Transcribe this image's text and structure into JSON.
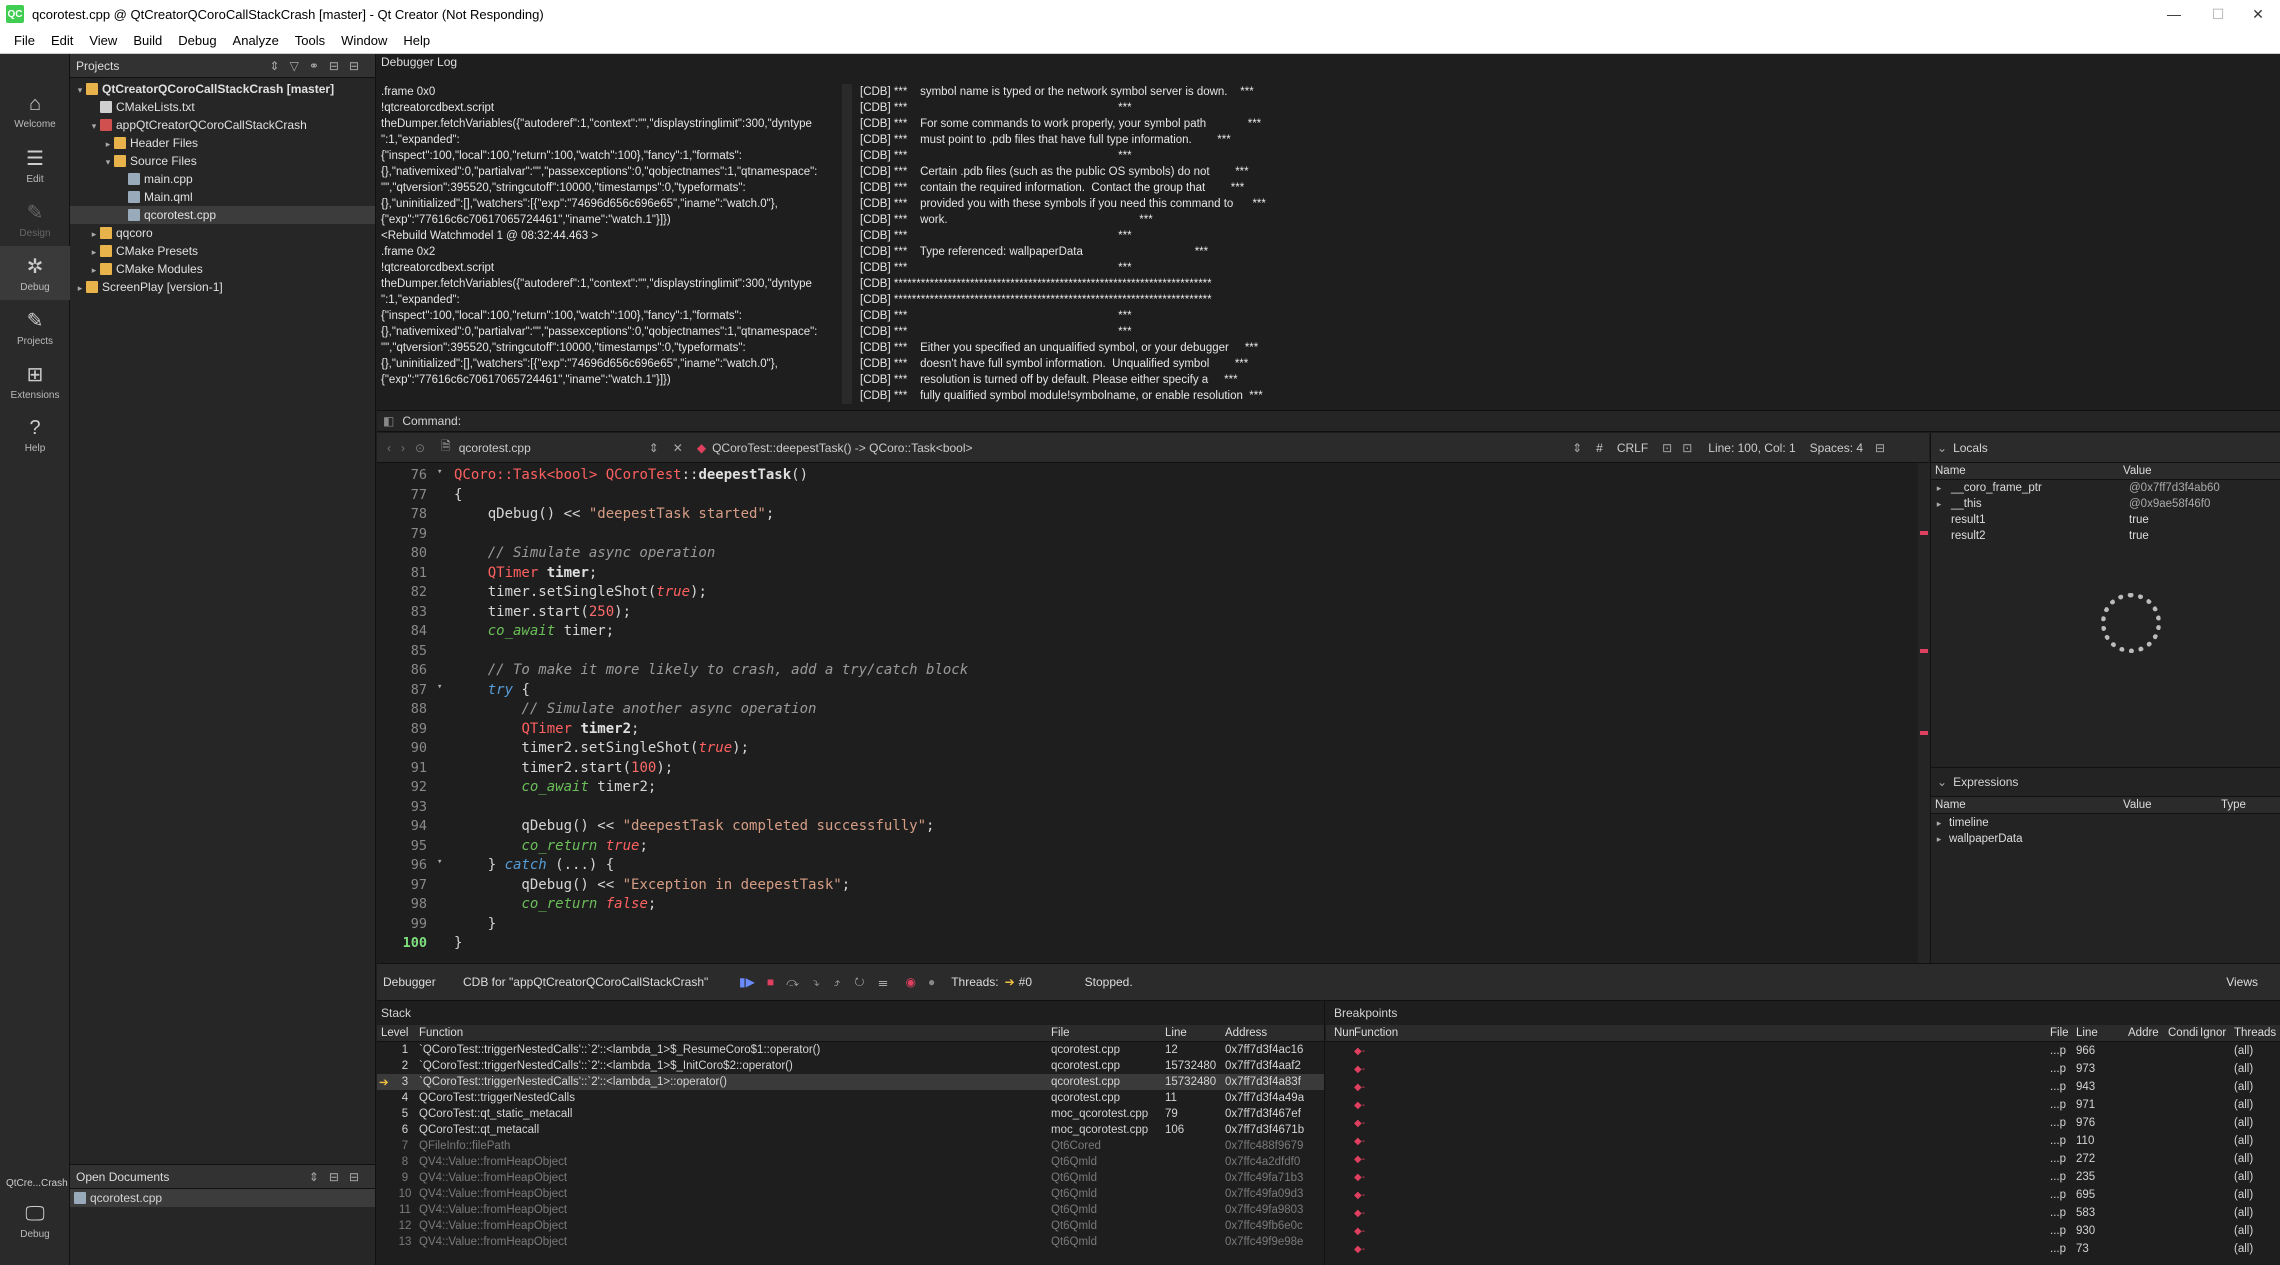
{
  "window": {
    "title": "qcorotest.cpp @ QtCreatorQCoroCallStackCrash [master] - Qt Creator (Not Responding)",
    "logo": "QC"
  },
  "menu": [
    "File",
    "Edit",
    "View",
    "Build",
    "Debug",
    "Analyze",
    "Tools",
    "Window",
    "Help"
  ],
  "modes": [
    {
      "label": "Welcome",
      "icon": "⌂"
    },
    {
      "label": "Edit",
      "icon": "☰"
    },
    {
      "label": "Design",
      "icon": "✎"
    },
    {
      "label": "Debug",
      "icon": "✲"
    },
    {
      "label": "Projects",
      "icon": "✎"
    },
    {
      "label": "Extensions",
      "icon": "⊞"
    },
    {
      "label": "Help",
      "icon": "?"
    }
  ],
  "kit": {
    "name": "QtCre...Crash",
    "mode": "Debug"
  },
  "projects": {
    "title": "Projects",
    "tree": [
      {
        "label": "QtCreatorQCoroCallStackCrash [master]",
        "indent": 0,
        "arrow": "▾",
        "color": "#e8b34a",
        "bold": true
      },
      {
        "label": "CMakeLists.txt",
        "indent": 1,
        "arrow": "",
        "color": "#cfcfcf"
      },
      {
        "label": "appQtCreatorQCoroCallStackCrash",
        "indent": 1,
        "arrow": "▾",
        "color": "#d05050"
      },
      {
        "label": "Header Files",
        "indent": 2,
        "arrow": "▸",
        "color": "#e8b34a"
      },
      {
        "label": "Source Files",
        "indent": 2,
        "arrow": "▾",
        "color": "#e8b34a"
      },
      {
        "label": "main.cpp",
        "indent": 3,
        "arrow": "",
        "color": "#9ab"
      },
      {
        "label": "Main.qml",
        "indent": 3,
        "arrow": "",
        "color": "#9ab"
      },
      {
        "label": "qcorotest.cpp",
        "indent": 3,
        "arrow": "",
        "color": "#9ab",
        "selected": true
      },
      {
        "label": "qqcoro",
        "indent": 1,
        "arrow": "▸",
        "color": "#e8b34a"
      },
      {
        "label": "CMake Presets",
        "indent": 1,
        "arrow": "▸",
        "color": "#e8b34a"
      },
      {
        "label": "CMake Modules",
        "indent": 1,
        "arrow": "▸",
        "color": "#e8b34a"
      },
      {
        "label": "ScreenPlay [version-1]",
        "indent": 0,
        "arrow": "▸",
        "color": "#e8b34a"
      }
    ]
  },
  "open_documents": {
    "title": "Open Documents",
    "items": [
      "qcorotest.cpp"
    ]
  },
  "debugger_log": {
    "title": "Debugger Log",
    "left": [
      ".frame 0x0",
      "!qtcreatorcdbext.script",
      "theDumper.fetchVariables({\"autoderef\":1,\"context\":\"\",\"displaystringlimit\":300,\"dyntype",
      "\":1,\"expanded\":",
      "{\"inspect\":100,\"local\":100,\"return\":100,\"watch\":100},\"fancy\":1,\"formats\":",
      "{},\"nativemixed\":0,\"partialvar\":\"\",\"passexceptions\":0,\"qobjectnames\":1,\"qtnamespace\":",
      "\"\",\"qtversion\":395520,\"stringcutoff\":10000,\"timestamps\":0,\"typeformats\":",
      "{},\"uninitialized\":[],\"watchers\":[{\"exp\":\"74696d656c696e65\",\"iname\":\"watch.0\"},",
      "{\"exp\":\"77616c6c70617065724461\",\"iname\":\"watch.1\"}]})",
      "<Rebuild Watchmodel 1 @ 08:32:44.463 >",
      ".frame 0x2",
      "!qtcreatorcdbext.script",
      "theDumper.fetchVariables({\"autoderef\":1,\"context\":\"\",\"displaystringlimit\":300,\"dyntype",
      "\":1,\"expanded\":",
      "{\"inspect\":100,\"local\":100,\"return\":100,\"watch\":100},\"fancy\":1,\"formats\":",
      "{},\"nativemixed\":0,\"partialvar\":\"\",\"passexceptions\":0,\"qobjectnames\":1,\"qtnamespace\":",
      "\"\",\"qtversion\":395520,\"stringcutoff\":10000,\"timestamps\":0,\"typeformats\":",
      "{},\"uninitialized\":[],\"watchers\":[{\"exp\":\"74696d656c696e65\",\"iname\":\"watch.0\"},",
      "{\"exp\":\"77616c6c70617065724461\",\"iname\":\"watch.1\"}]})"
    ],
    "right": [
      "[CDB] ***    symbol name is typed or the network symbol server is down.    ***",
      "[CDB] ***                                                                  ***",
      "[CDB] ***    For some commands to work properly, your symbol path             ***",
      "[CDB] ***    must point to .pdb files that have full type information.        ***",
      "[CDB] ***                                                                  ***",
      "[CDB] ***    Certain .pdb files (such as the public OS symbols) do not        ***",
      "[CDB] ***    contain the required information.  Contact the group that        ***",
      "[CDB] ***    provided you with these symbols if you need this command to      ***",
      "[CDB] ***    work.                                                            ***",
      "[CDB] ***                                                                  ***",
      "[CDB] ***    Type referenced: wallpaperData                                   ***",
      "[CDB] ***                                                                  ***",
      "[CDB] ***********************************************************************",
      "[CDB] ***********************************************************************",
      "[CDB] ***                                                                  ***",
      "[CDB] ***                                                                  ***",
      "[CDB] ***    Either you specified an unqualified symbol, or your debugger     ***",
      "[CDB] ***    doesn't have full symbol information.  Unqualified symbol        ***",
      "[CDB] ***    resolution is turned off by default. Please either specify a     ***",
      "[CDB] ***    fully qualified symbol module!symbolname, or enable resolution  ***"
    ]
  },
  "command": {
    "label": "Command:"
  },
  "editor_toolbar": {
    "file": "qcorotest.cpp",
    "function": "QCoroTest::deepestTask() -> QCoro::Task<bool>",
    "hash": "#",
    "eol": "CRLF",
    "position": "Line: 100, Col: 1",
    "spaces": "Spaces: 4"
  },
  "code": {
    "current_line": "100",
    "lines": [
      {
        "n": "76",
        "fold": "▾",
        "html": "<span class='ty'>QCoro::Task&lt;bool&gt;</span> <span class='ty'>QCoroTest</span>::<span class='fn'>deepestTask</span>()"
      },
      {
        "n": "77",
        "fold": "",
        "html": "{"
      },
      {
        "n": "78",
        "fold": "",
        "html": "    qDebug() &lt;&lt; <span class='st'>\"deepestTask started\"</span>;"
      },
      {
        "n": "79",
        "fold": "",
        "html": ""
      },
      {
        "n": "80",
        "fold": "",
        "html": "    <span class='cm'>// Simulate async operation</span>"
      },
      {
        "n": "81",
        "fold": "",
        "html": "    <span class='ty'>QTimer</span> <span class='fn'>timer</span>;"
      },
      {
        "n": "82",
        "fold": "",
        "html": "    timer.setSingleShot(<span class='bo'>true</span>);"
      },
      {
        "n": "83",
        "fold": "",
        "html": "    timer.start(<span class='nu'>250</span>);"
      },
      {
        "n": "84",
        "fold": "",
        "html": "    <span class='cr'>co_await</span> timer;"
      },
      {
        "n": "85",
        "fold": "",
        "html": ""
      },
      {
        "n": "86",
        "fold": "",
        "html": "    <span class='cm'>// To make it more likely to crash, add a try/catch block</span>"
      },
      {
        "n": "87",
        "fold": "▾",
        "html": "    <span class='kw'>try</span> {"
      },
      {
        "n": "88",
        "fold": "",
        "html": "        <span class='cm'>// Simulate another async operation</span>"
      },
      {
        "n": "89",
        "fold": "",
        "html": "        <span class='ty'>QTimer</span> <span class='fn'>timer2</span>;"
      },
      {
        "n": "90",
        "fold": "",
        "html": "        timer2.setSingleShot(<span class='bo'>true</span>);"
      },
      {
        "n": "91",
        "fold": "",
        "html": "        timer2.start(<span class='nu'>100</span>);"
      },
      {
        "n": "92",
        "fold": "",
        "html": "        <span class='cr'>co_await</span> timer2;"
      },
      {
        "n": "93",
        "fold": "",
        "html": ""
      },
      {
        "n": "94",
        "fold": "",
        "html": "        qDebug() &lt;&lt; <span class='st'>\"deepestTask completed successfully\"</span>;"
      },
      {
        "n": "95",
        "fold": "",
        "html": "        <span class='cr'>co_return</span> <span class='bo'>true</span>;"
      },
      {
        "n": "96",
        "fold": "▾",
        "html": "    } <span class='kw'>catch</span> (...) {"
      },
      {
        "n": "97",
        "fold": "",
        "html": "        qDebug() &lt;&lt; <span class='st'>\"Exception in deepestTask\"</span>;"
      },
      {
        "n": "98",
        "fold": "",
        "html": "        <span class='cr'>co_return</span> <span class='bo'>false</span>;"
      },
      {
        "n": "99",
        "fold": "",
        "html": "    }"
      },
      {
        "n": "100",
        "fold": "",
        "html": "}"
      }
    ]
  },
  "locals": {
    "title": "Locals",
    "cols": [
      "Name",
      "Value"
    ],
    "rows": [
      {
        "name": "__coro_frame_ptr",
        "value": "@0x7ff7d3f4ab60",
        "arrow": "▸",
        "gray": true
      },
      {
        "name": "__this",
        "value": "@0x9ae58f46f0",
        "arrow": "▸",
        "gray": true
      },
      {
        "name": "result1",
        "value": "true",
        "arrow": ""
      },
      {
        "name": "result2",
        "value": "true",
        "arrow": ""
      }
    ]
  },
  "expressions": {
    "title": "Expressions",
    "cols": [
      "Name",
      "Value",
      "Type"
    ],
    "rows": [
      "timeline",
      "wallpaperData"
    ]
  },
  "debugger_bar": {
    "label": "Debugger",
    "engine": "CDB for \"appQtCreatorQCoroCallStackCrash\"",
    "threads_label": "Threads:",
    "thread": "#0",
    "status": "Stopped.",
    "views": "Views"
  },
  "stack": {
    "title": "Stack",
    "cols": [
      "Level",
      "Function",
      "File",
      "Line",
      "Address"
    ],
    "rows": [
      {
        "level": "1",
        "fn": "`QCoroTest::triggerNestedCalls'::`2'::<lambda_1>$_ResumeCoro$1::operator()",
        "file": "qcorotest.cpp",
        "line": "12",
        "addr": "0x7ff7d3f4ac16"
      },
      {
        "level": "2",
        "fn": "`QCoroTest::triggerNestedCalls'::`2'::<lambda_1>$_InitCoro$2::operator()",
        "file": "qcorotest.cpp",
        "line": "15732480",
        "addr": "0x7ff7d3f4aaf2"
      },
      {
        "level": "3",
        "fn": "`QCoroTest::triggerNestedCalls'::`2'::<lambda_1>::operator()",
        "file": "qcorotest.cpp",
        "line": "15732480",
        "addr": "0x7ff7d3f4a83f",
        "current": true
      },
      {
        "level": "4",
        "fn": "QCoroTest::triggerNestedCalls",
        "file": "qcorotest.cpp",
        "line": "11",
        "addr": "0x7ff7d3f4a49a"
      },
      {
        "level": "5",
        "fn": "QCoroTest::qt_static_metacall",
        "file": "moc_qcorotest.cpp",
        "line": "79",
        "addr": "0x7ff7d3f467ef"
      },
      {
        "level": "6",
        "fn": "QCoroTest::qt_metacall",
        "file": "moc_qcorotest.cpp",
        "line": "106",
        "addr": "0x7ff7d3f4671b"
      },
      {
        "level": "7",
        "fn": "QFileInfo::filePath",
        "file": "Qt6Cored",
        "line": "",
        "addr": "0x7ffc488f9679",
        "gray": true
      },
      {
        "level": "8",
        "fn": "QV4::Value::fromHeapObject",
        "file": "Qt6Qmld",
        "line": "",
        "addr": "0x7ffc4a2dfdf0",
        "gray": true
      },
      {
        "level": "9",
        "fn": "QV4::Value::fromHeapObject",
        "file": "Qt6Qmld",
        "line": "",
        "addr": "0x7ffc49fa71b3",
        "gray": true
      },
      {
        "level": "10",
        "fn": "QV4::Value::fromHeapObject",
        "file": "Qt6Qmld",
        "line": "",
        "addr": "0x7ffc49fa09d3",
        "gray": true
      },
      {
        "level": "11",
        "fn": "QV4::Value::fromHeapObject",
        "file": "Qt6Qmld",
        "line": "",
        "addr": "0x7ffc49fa9803",
        "gray": true
      },
      {
        "level": "12",
        "fn": "QV4::Value::fromHeapObject",
        "file": "Qt6Qmld",
        "line": "",
        "addr": "0x7ffc49fb6e0c",
        "gray": true
      },
      {
        "level": "13",
        "fn": "QV4::Value::fromHeapObject",
        "file": "Qt6Qmld",
        "line": "",
        "addr": "0x7ffc49f9e98e",
        "gray": true
      }
    ]
  },
  "breakpoints": {
    "title": "Breakpoints",
    "cols": [
      "Num",
      "Function",
      "File",
      "Line",
      "Addre",
      "Condi",
      "Ignor",
      "Threads"
    ],
    "rows": [
      {
        "file": "...p",
        "line": "966",
        "threads": "(all)"
      },
      {
        "file": "...p",
        "line": "973",
        "threads": "(all)"
      },
      {
        "file": "...p",
        "line": "943",
        "threads": "(all)"
      },
      {
        "file": "...p",
        "line": "971",
        "threads": "(all)"
      },
      {
        "file": "...p",
        "line": "976",
        "threads": "(all)"
      },
      {
        "file": "...p",
        "line": "110",
        "threads": "(all)"
      },
      {
        "file": "...p",
        "line": "272",
        "threads": "(all)"
      },
      {
        "file": "...p",
        "line": "235",
        "threads": "(all)"
      },
      {
        "file": "...p",
        "line": "695",
        "threads": "(all)"
      },
      {
        "file": "...p",
        "line": "583",
        "threads": "(all)"
      },
      {
        "file": "...p",
        "line": "930",
        "threads": "(all)"
      },
      {
        "file": "...p",
        "line": "73",
        "threads": "(all)"
      }
    ]
  }
}
